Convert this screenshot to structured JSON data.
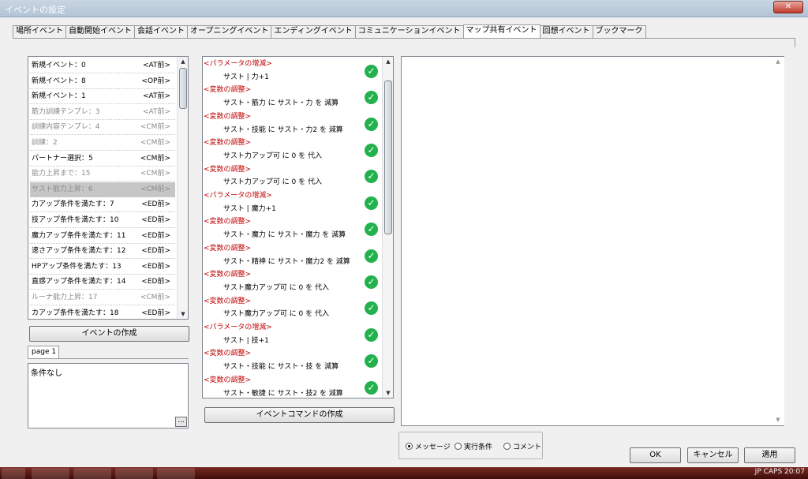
{
  "window": {
    "title": "イベントの設定",
    "close_label": "✕"
  },
  "tabs": [
    {
      "label": "場所イベント",
      "active": false
    },
    {
      "label": "自動開始イベント",
      "active": false
    },
    {
      "label": "会話イベント",
      "active": false
    },
    {
      "label": "オープニングイベント",
      "active": false
    },
    {
      "label": "エンディングイベント",
      "active": false
    },
    {
      "label": "コミュニケーションイベント",
      "active": false
    },
    {
      "label": "マップ共有イベント",
      "active": true
    },
    {
      "label": "回想イベント",
      "active": false
    },
    {
      "label": "ブックマーク",
      "active": false
    }
  ],
  "event_list": {
    "items": [
      {
        "name": "新規イベント：0",
        "tag": "<AT前>",
        "state": "normal"
      },
      {
        "name": "新規イベント：8",
        "tag": "<OP前>",
        "state": "normal"
      },
      {
        "name": "新規イベント：1",
        "tag": "<AT前>",
        "state": "normal"
      },
      {
        "name": "筋力訓練テンプレ：3",
        "tag": "<AT前>",
        "state": "dim"
      },
      {
        "name": "訓練内容テンプレ：4",
        "tag": "<CM前>",
        "state": "dim"
      },
      {
        "name": "訓練：2",
        "tag": "<CM前>",
        "state": "dim"
      },
      {
        "name": "パートナー選択：5",
        "tag": "<CM前>",
        "state": "normal"
      },
      {
        "name": "能力上昇まで：15",
        "tag": "<CM前>",
        "state": "dim"
      },
      {
        "name": "サスト能力上昇：6",
        "tag": "<CM前>",
        "state": "selected"
      },
      {
        "name": "力アップ条件を満たす：7",
        "tag": "<ED前>",
        "state": "normal"
      },
      {
        "name": "技アップ条件を満たす：10",
        "tag": "<ED前>",
        "state": "normal"
      },
      {
        "name": "魔力アップ条件を満たす：11",
        "tag": "<ED前>",
        "state": "normal"
      },
      {
        "name": "速さアップ条件を満たす：12",
        "tag": "<ED前>",
        "state": "normal"
      },
      {
        "name": "HPアップ条件を満たす：13",
        "tag": "<ED前>",
        "state": "normal"
      },
      {
        "name": "直感アップ条件を満たす：14",
        "tag": "<ED前>",
        "state": "normal"
      },
      {
        "name": "ルーナ能力上昇：17",
        "tag": "<CM前>",
        "state": "dim"
      },
      {
        "name": "カアップ条件を満たす：18",
        "tag": "<ED前>",
        "state": "normal"
      }
    ],
    "scroll_up": "▲",
    "scroll_down": "▼"
  },
  "create_event_label": "イベントの作成",
  "page_tab_label": "page 1",
  "condition_text": "条件なし",
  "dots_label": "...",
  "commands": {
    "rows": [
      {
        "text": "<パラメータの増減>",
        "kind": "header"
      },
      {
        "text": "サスト | 力+1",
        "kind": "body"
      },
      {
        "text": "<変数の調整>",
        "kind": "header"
      },
      {
        "text": "サスト・筋力 に サスト・力 を 減算",
        "kind": "body"
      },
      {
        "text": "<変数の調整>",
        "kind": "header"
      },
      {
        "text": "サスト・技能 に サスト・力2 を 減算",
        "kind": "body"
      },
      {
        "text": "<変数の調整>",
        "kind": "header"
      },
      {
        "text": "サスト力アップ可 に 0 を 代入",
        "kind": "body"
      },
      {
        "text": "<変数の調整>",
        "kind": "header"
      },
      {
        "text": "サスト力アップ可 に 0 を 代入",
        "kind": "body"
      },
      {
        "text": "<パラメータの増減>",
        "kind": "header"
      },
      {
        "text": "サスト | 魔力+1",
        "kind": "body"
      },
      {
        "text": "<変数の調整>",
        "kind": "header"
      },
      {
        "text": "サスト・魔力 に サスト・魔力 を 減算",
        "kind": "body"
      },
      {
        "text": "<変数の調整>",
        "kind": "header"
      },
      {
        "text": "サスト・精神 に サスト・魔力2 を 減算",
        "kind": "body"
      },
      {
        "text": "<変数の調整>",
        "kind": "header"
      },
      {
        "text": "サスト魔力アップ可 に 0 を 代入",
        "kind": "body"
      },
      {
        "text": "<変数の調整>",
        "kind": "header"
      },
      {
        "text": "サスト魔力アップ可 に 0 を 代入",
        "kind": "body"
      },
      {
        "text": "<パラメータの増減>",
        "kind": "header"
      },
      {
        "text": "サスト | 技+1",
        "kind": "body"
      },
      {
        "text": "<変数の調整>",
        "kind": "header"
      },
      {
        "text": "サスト・技能 に サスト・技 を 減算",
        "kind": "body"
      },
      {
        "text": "<変数の調整>",
        "kind": "header"
      },
      {
        "text": "サスト・敏捷 に サスト・技2 を 減算",
        "kind": "body"
      }
    ],
    "check_glyph": "✓",
    "scroll_up": "▲",
    "scroll_down": "▼"
  },
  "create_command_label": "イベントコマンドの作成",
  "preview": {
    "scroll_up": "▲",
    "scroll_down": "▼"
  },
  "radio": [
    {
      "label": "メッセージ",
      "checked": true
    },
    {
      "label": "実行条件",
      "checked": false
    },
    {
      "label": "コメント",
      "checked": false
    }
  ],
  "buttons": {
    "ok": "OK",
    "cancel": "キャンセル",
    "apply": "適用"
  },
  "taskbar": {
    "tray_text": "JP  CAPS  20:07"
  },
  "colors": {
    "header_red": "#c00000",
    "check_green": "#22b14c",
    "selected_gray": "#c6c6c6"
  }
}
